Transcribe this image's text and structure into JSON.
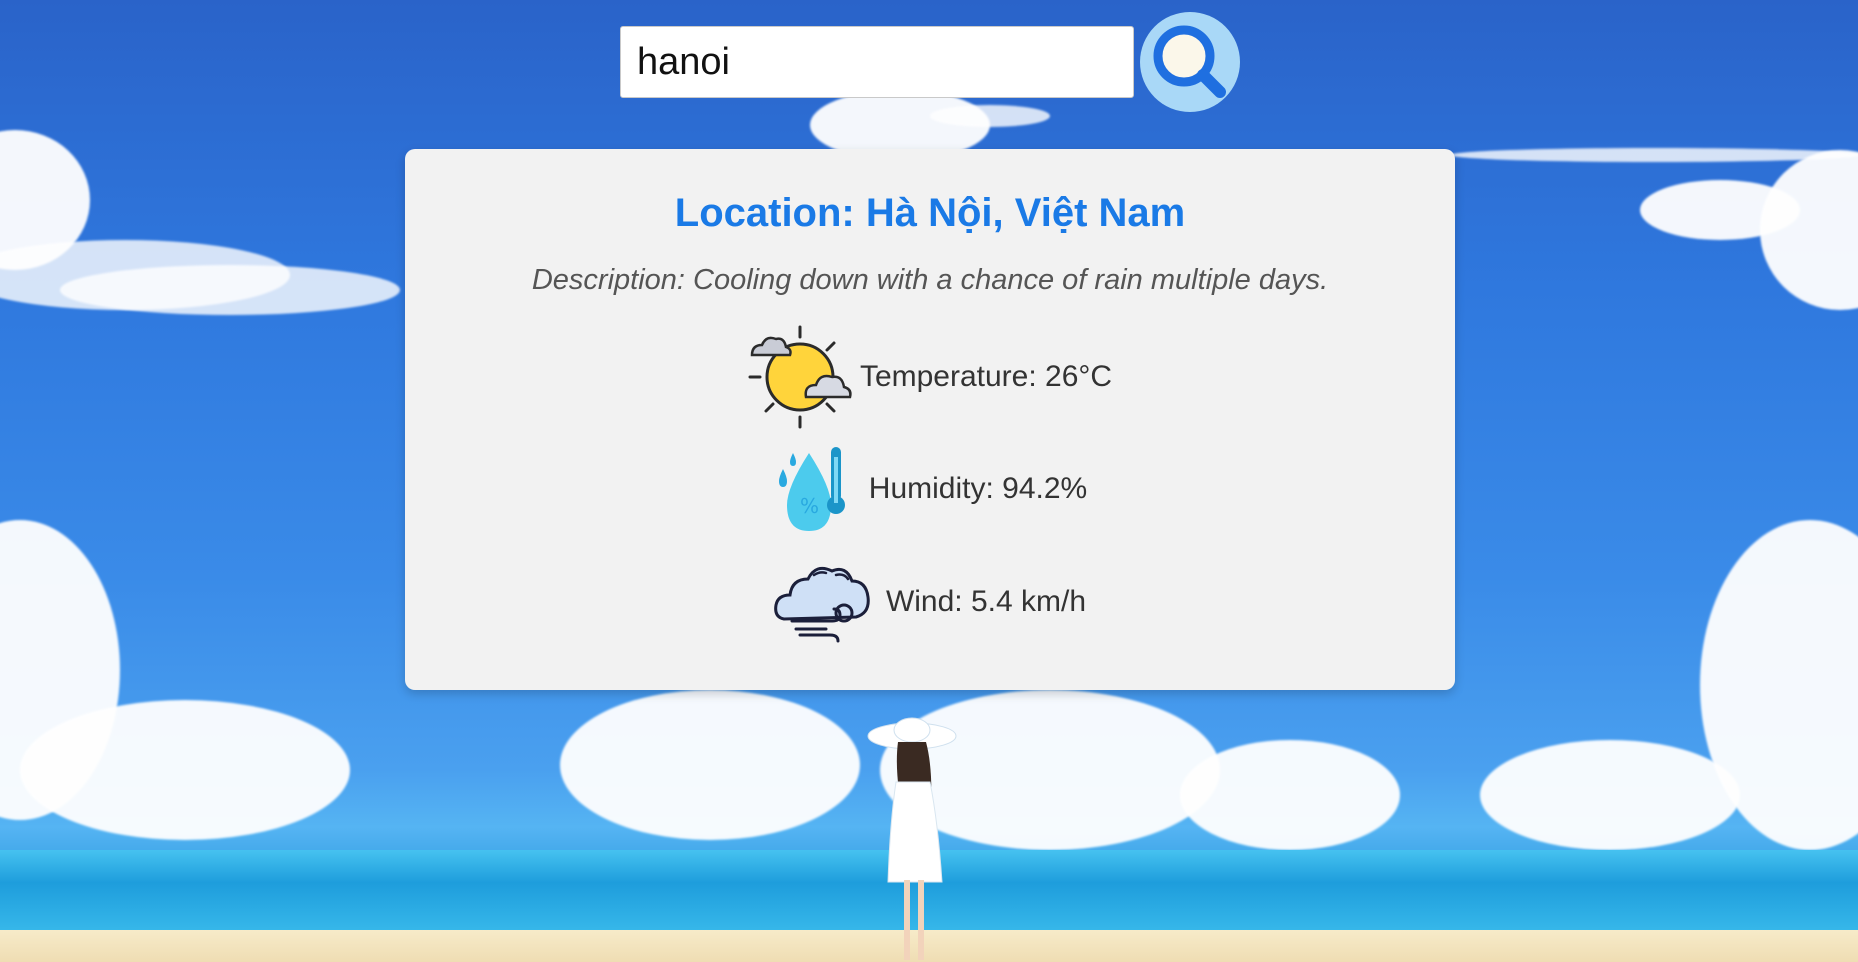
{
  "search": {
    "value": "hanoi",
    "button_icon": "search-icon"
  },
  "weather": {
    "location": "Location: Hà Nội, Việt Nam",
    "description": "Description: Cooling down with a chance of rain multiple days.",
    "temperature": "Temperature: 26°C",
    "humidity": "Humidity: 94.2%",
    "wind": "Wind: 5.4 km/h",
    "temperature_icon": "sun-cloud-icon",
    "humidity_icon": "humidity-drop-thermometer-icon",
    "wind_icon": "wind-cloud-icon"
  },
  "colors": {
    "title": "#1a7ae6",
    "card_background": "#f2f2f2",
    "search_button": "#a9d8f7"
  }
}
